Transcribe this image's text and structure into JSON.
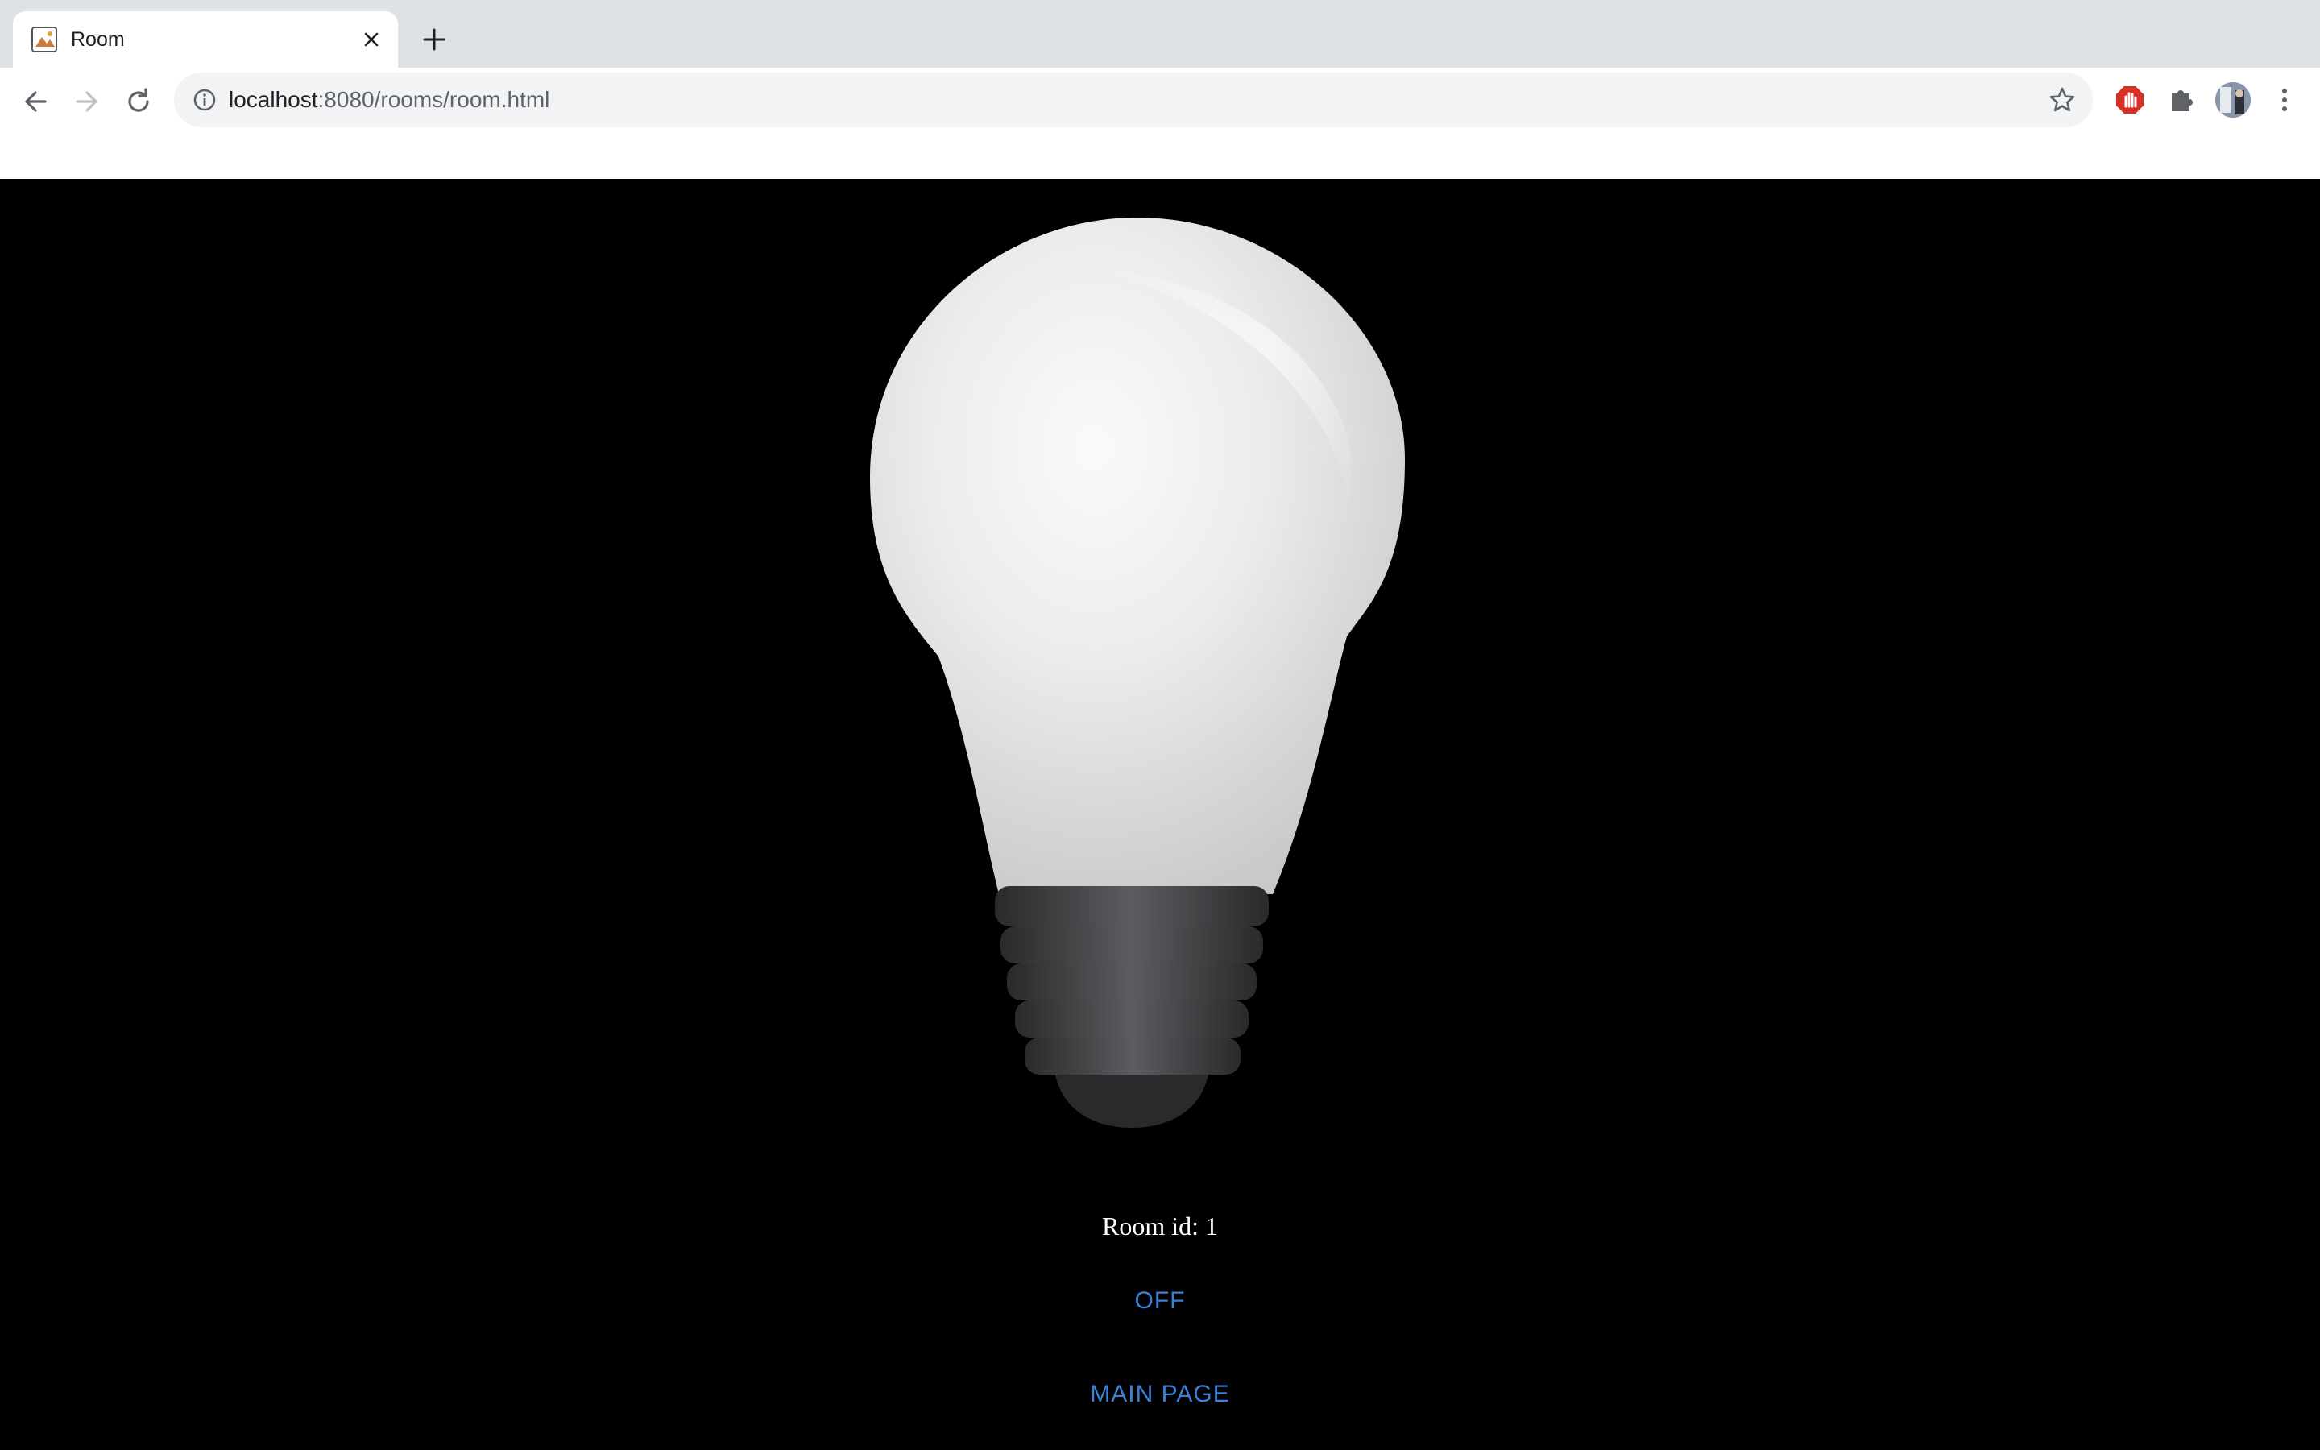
{
  "browser": {
    "tab": {
      "title": "Room",
      "favicon": "room-favicon-icon"
    },
    "new_tab_label": "+",
    "address": {
      "host": "localhost",
      "path": ":8080/rooms/room.html"
    },
    "icons": {
      "back": "arrow-left-icon",
      "forward": "arrow-right-icon",
      "reload": "reload-icon",
      "info": "info-icon",
      "bookmark": "star-icon",
      "adblock": "stop-hand-icon",
      "extensions": "puzzle-icon",
      "profile": "avatar",
      "menu": "kebab-menu-icon"
    }
  },
  "page": {
    "room_label": "Room id: 1",
    "toggle_label": "OFF",
    "main_page_label": "MAIN PAGE",
    "bulb_state": "off"
  },
  "colors": {
    "page_background": "#000000",
    "link": "#3b82d6",
    "text": "#ffffff",
    "chrome_tabstrip": "#dee1e6",
    "omnibox": "#f1f3f4"
  }
}
